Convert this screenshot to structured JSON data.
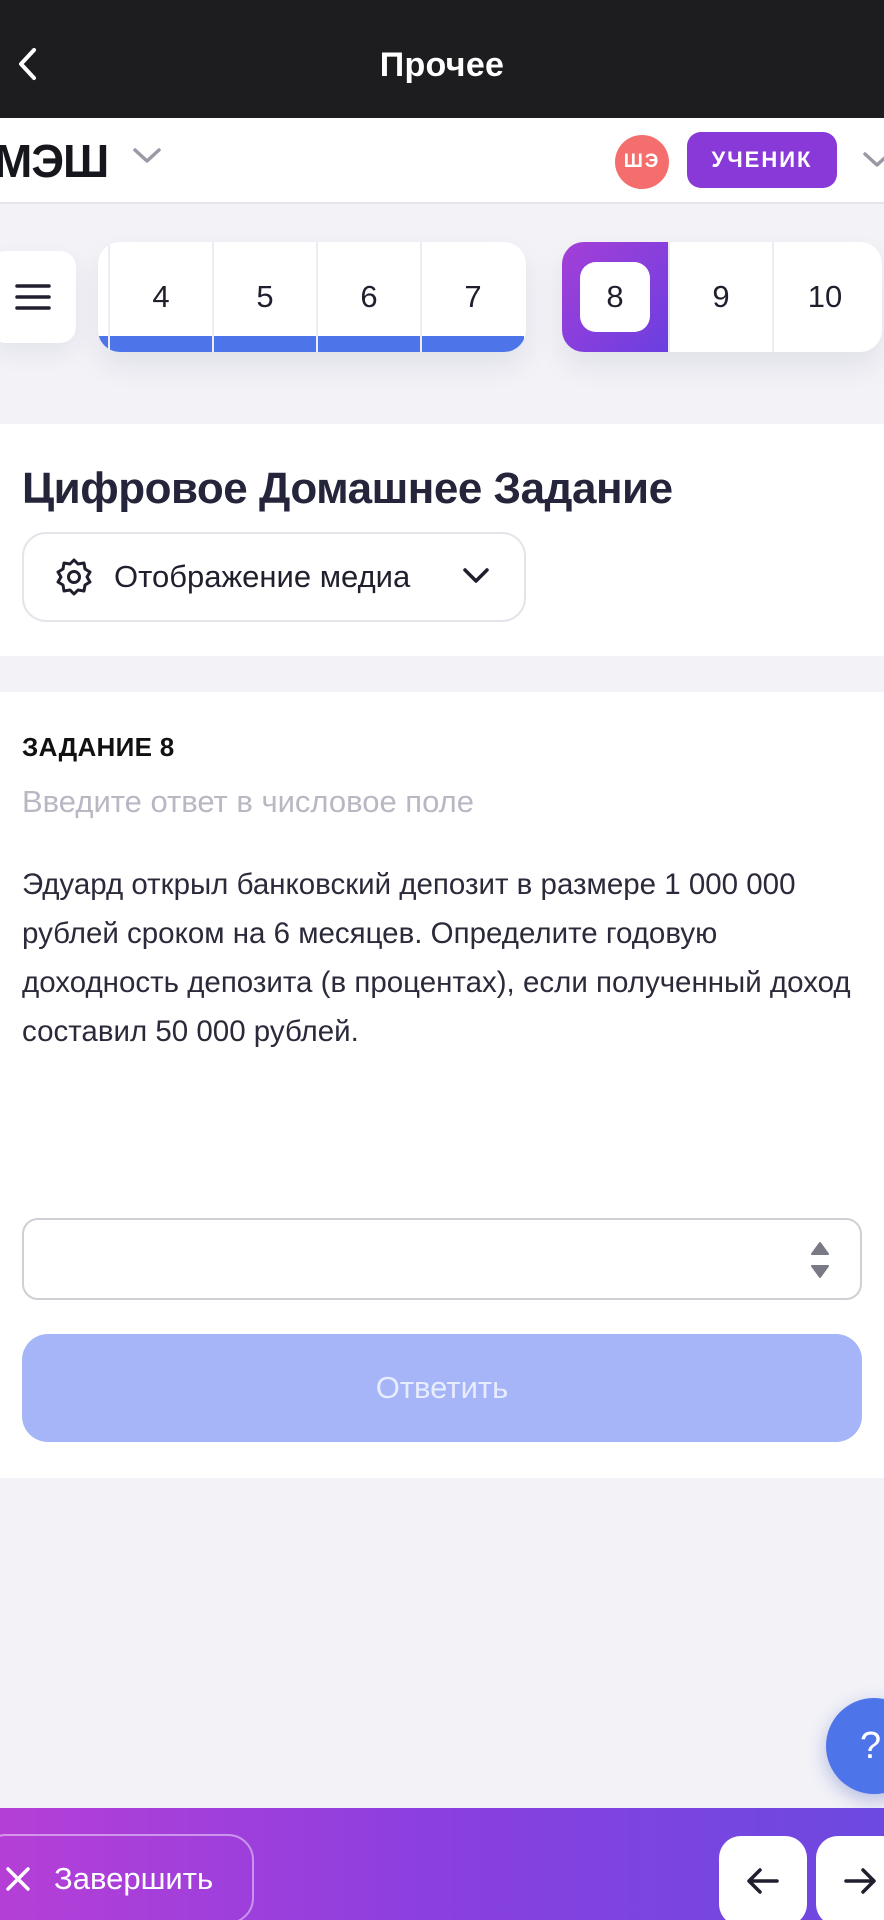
{
  "topbar": {
    "title": "Прочее"
  },
  "header": {
    "logo": "МЭШ",
    "avatar_initials": "ШЭ",
    "role": "УЧЕНИК"
  },
  "task_nav": {
    "completed": [
      "4",
      "5",
      "6",
      "7"
    ],
    "current": "8",
    "upcoming": [
      "9",
      "10"
    ]
  },
  "page": {
    "title": "Цифровое Домашнее Задание",
    "media_dropdown": "Отображение медиа"
  },
  "task": {
    "number_label": "ЗАДАНИЕ 8",
    "hint": "Введите ответ в числовое поле",
    "text": "Эдуард открыл банковский депозит в размере 1 000 000 рублей сроком на 6 месяцев. Определите годовую доходность депозита (в процентах), если полученный доход составил 50 000 рублей.",
    "answer_value": "",
    "submit_label": "Ответить"
  },
  "help": {
    "label": "?"
  },
  "bottom": {
    "finish_label": "Завершить"
  },
  "colors": {
    "accent_blue": "#4d74e8",
    "accent_purple": "#8a39d9",
    "avatar_red": "#f46e6e",
    "submit_disabled": "#a5b5f7"
  },
  "icons": {
    "back": "chevron-left-icon",
    "menu": "hamburger-icon",
    "media": "gear-icon",
    "finish": "close-icon",
    "prev": "arrow-left-icon",
    "next": "arrow-right-icon"
  }
}
